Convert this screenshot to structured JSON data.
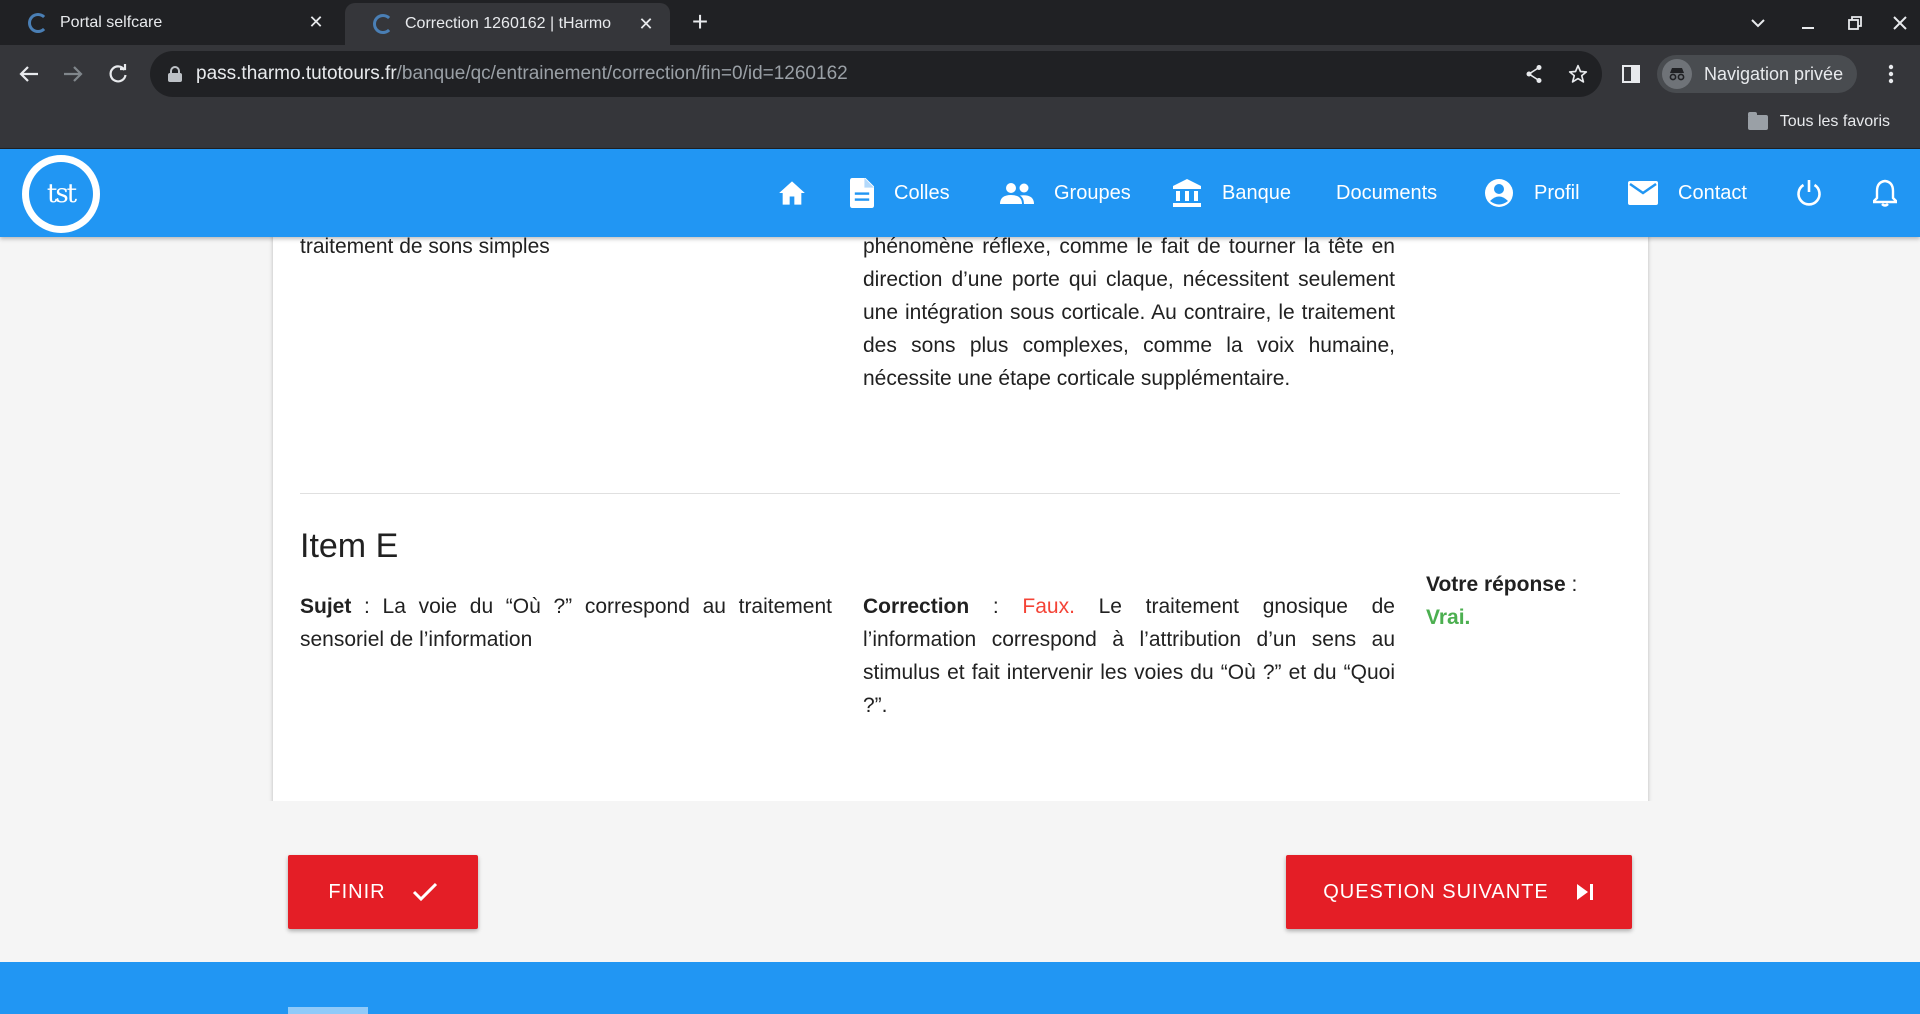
{
  "browser": {
    "tabs": [
      {
        "title": "Portal selfcare",
        "close": "✕"
      },
      {
        "title": "Correction 1260162 | tHarmo",
        "close": "✕"
      }
    ],
    "new_tab": "+",
    "url_host": "pass.tharmo.tutotours.fr",
    "url_path": "/banque/qc/entrainement/correction/fin=0/id=1260162",
    "incognito_label": "Navigation privée",
    "bookmarks_all": "Tous les favoris"
  },
  "header": {
    "logo_text": "tst",
    "nav": {
      "colles": "Colles",
      "groupes": "Groupes",
      "banque": "Banque",
      "documents": "Documents",
      "profil": "Profil",
      "contact": "Contact"
    }
  },
  "item_d": {
    "subject_tail": "traitement de sons simples",
    "correction_tail": "phénomène réflexe, comme le fait de tourner la tête en direction d’une porte qui claque, nécessitent seulement une intégration sous corticale. Au contraire, le traitement des sons plus complexes, comme la voix humaine, nécessite une étape corticale supplémentaire."
  },
  "item_e": {
    "title": "Item E",
    "subject_label": "Sujet",
    "subject_sep": " : ",
    "subject_text": "La voie du “Où ?” correspond au traitement sensoriel de l’information",
    "correction_label": "Correction",
    "correction_sep": " : ",
    "correction_verdict": "Faux.",
    "correction_text": " Le traitement gnosique de l’information correspond à l’attribution d’un sens au stimulus et fait intervenir les voies du “Où ?” et du “Quoi ?”.",
    "answer_label": "Votre réponse",
    "answer_sep": " :",
    "answer_value": "Vrai."
  },
  "buttons": {
    "finish": "FINIR",
    "next": "QUESTION SUIVANTE"
  },
  "colors": {
    "brand_blue": "#2196f3",
    "button_red": "#e41e26",
    "wrong_red": "#f44336",
    "answer_green": "#4caf50"
  }
}
